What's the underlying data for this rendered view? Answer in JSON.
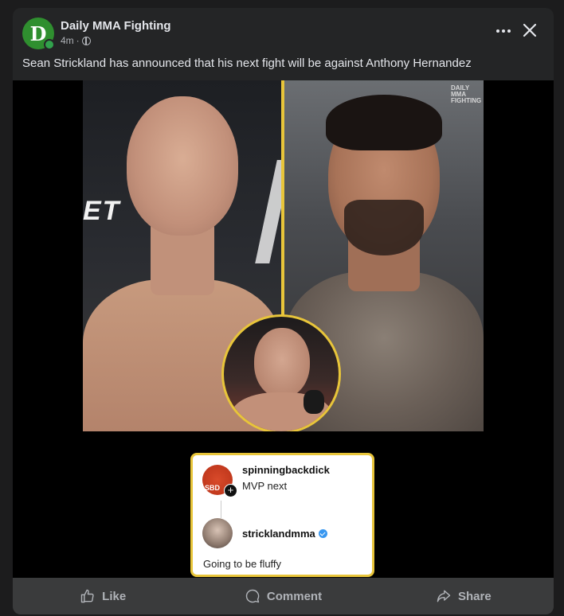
{
  "post": {
    "page_name": "Daily MMA Fighting",
    "avatar_letter": "D",
    "time": "4m",
    "separator": "·",
    "caption": "Sean Strickland has announced that his next fight will be against Anthony Hernandez"
  },
  "media": {
    "watermark": [
      "DAILY",
      "MMA",
      "FIGHTING"
    ],
    "banner_text": "ET",
    "comments": [
      {
        "user": "spinningbackdick",
        "text": "MVP next",
        "avatar_initials": "SBD"
      },
      {
        "user": "stricklandmma",
        "text": "Going to be fluffy",
        "verified": true
      }
    ]
  },
  "actions": {
    "like": "Like",
    "comment": "Comment",
    "share": "Share"
  },
  "colors": {
    "card_bg": "#242526",
    "accent_yellow": "#e8c53a",
    "brand_green": "#2f8f2f",
    "action_bar": "#3a3b3c"
  }
}
